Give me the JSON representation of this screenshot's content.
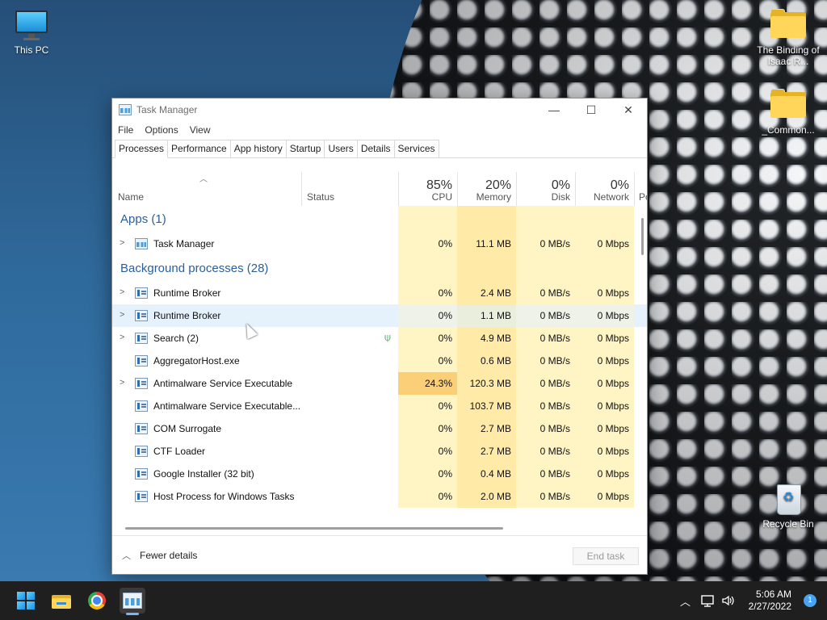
{
  "desktop": {
    "icons": [
      {
        "label": "This PC",
        "icon": "monitor-icon"
      },
      {
        "label": "The Binding of Isaac R...",
        "icon": "folder-icon"
      },
      {
        "label": "_Common...",
        "icon": "folder-icon"
      },
      {
        "label": "Recycle Bin",
        "icon": "recycle-bin-icon"
      }
    ]
  },
  "window": {
    "title": "Task Manager",
    "controls": {
      "minimize": "—",
      "maximize": "☐",
      "close": "✕"
    },
    "menu": [
      "File",
      "Options",
      "View"
    ],
    "tabs": [
      "Processes",
      "Performance",
      "App history",
      "Startup",
      "Users",
      "Details",
      "Services"
    ],
    "active_tab": "Processes"
  },
  "columns": {
    "name": "Name",
    "status": "Status",
    "cpu": {
      "label": "CPU",
      "pct": "85%"
    },
    "memory": {
      "label": "Memory",
      "pct": "20%"
    },
    "disk": {
      "label": "Disk",
      "pct": "0%"
    },
    "network": {
      "label": "Network",
      "pct": "0%"
    },
    "power_partial": "Po"
  },
  "groups": {
    "apps": "Apps (1)",
    "background": "Background processes (28)"
  },
  "apps": [
    {
      "name": "Task Manager",
      "expandable": true,
      "cpu": "0%",
      "memory": "11.1 MB",
      "disk": "0 MB/s",
      "network": "0 Mbps"
    }
  ],
  "background": [
    {
      "name": "Runtime Broker",
      "expandable": true,
      "cpu": "0%",
      "memory": "2.4 MB",
      "disk": "0 MB/s",
      "network": "0 Mbps"
    },
    {
      "name": "Runtime Broker",
      "expandable": true,
      "cpu": "0%",
      "memory": "1.1 MB",
      "disk": "0 MB/s",
      "network": "0 Mbps",
      "hover": true
    },
    {
      "name": "Search (2)",
      "expandable": true,
      "cpu": "0%",
      "memory": "4.9 MB",
      "disk": "0 MB/s",
      "network": "0 Mbps",
      "suspended": true
    },
    {
      "name": "AggregatorHost.exe",
      "expandable": false,
      "cpu": "0%",
      "memory": "0.6 MB",
      "disk": "0 MB/s",
      "network": "0 Mbps"
    },
    {
      "name": "Antimalware Service Executable",
      "expandable": true,
      "cpu": "24.3%",
      "memory": "120.3 MB",
      "disk": "0 MB/s",
      "network": "0 Mbps",
      "hot": true
    },
    {
      "name": "Antimalware Service Executable...",
      "expandable": false,
      "cpu": "0%",
      "memory": "103.7 MB",
      "disk": "0 MB/s",
      "network": "0 Mbps"
    },
    {
      "name": "COM Surrogate",
      "expandable": false,
      "cpu": "0%",
      "memory": "2.7 MB",
      "disk": "0 MB/s",
      "network": "0 Mbps"
    },
    {
      "name": "CTF Loader",
      "expandable": false,
      "cpu": "0%",
      "memory": "2.7 MB",
      "disk": "0 MB/s",
      "network": "0 Mbps"
    },
    {
      "name": "Google Installer (32 bit)",
      "expandable": false,
      "cpu": "0%",
      "memory": "0.4 MB",
      "disk": "0 MB/s",
      "network": "0 Mbps"
    },
    {
      "name": "Host Process for Windows Tasks",
      "expandable": false,
      "cpu": "0%",
      "memory": "2.0 MB",
      "disk": "0 MB/s",
      "network": "0 Mbps"
    }
  ],
  "footer": {
    "fewer_details": "Fewer details",
    "end_task": "End task"
  },
  "taskbar": {
    "time": "5:06 AM",
    "date": "2/27/2022",
    "notifications": "1",
    "pinned": [
      "start-icon",
      "file-explorer-icon",
      "chrome-icon",
      "task-manager-icon"
    ]
  },
  "colors": {
    "group_heading": "#2a5f9e",
    "heat_light": "#fff4c4",
    "heat_mid": "#ffeaa8",
    "heat_hot": "#fbcf78",
    "hover_row": "#e5f1fb"
  }
}
